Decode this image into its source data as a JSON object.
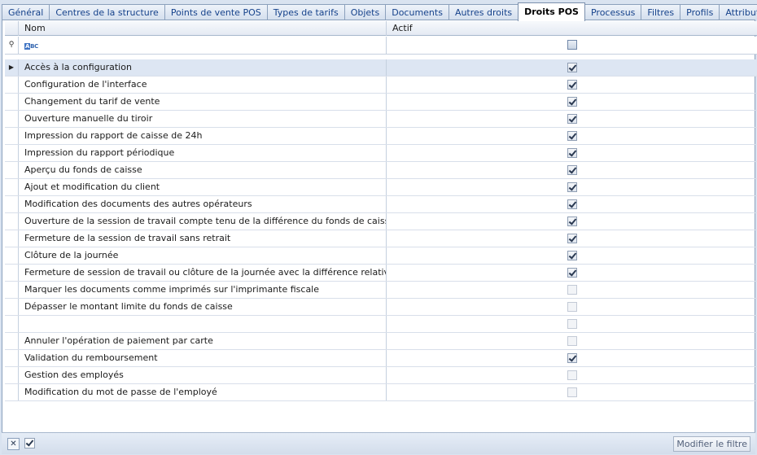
{
  "tabs": [
    {
      "label": "Général",
      "active": false
    },
    {
      "label": "Centres de la structure",
      "active": false
    },
    {
      "label": "Points de vente POS",
      "active": false
    },
    {
      "label": "Types de tarifs",
      "active": false
    },
    {
      "label": "Objets",
      "active": false
    },
    {
      "label": "Documents",
      "active": false
    },
    {
      "label": "Autres droits",
      "active": false
    },
    {
      "label": "Droits POS",
      "active": true
    },
    {
      "label": "Processus",
      "active": false
    },
    {
      "label": "Filtres",
      "active": false
    },
    {
      "label": "Profils",
      "active": false
    },
    {
      "label": "Attributs",
      "active": false
    }
  ],
  "grid": {
    "columns": {
      "nom": "Nom",
      "actif": "Actif"
    },
    "filter_row": {
      "pin_icon": "pin-icon",
      "abc_icon": "abc-filter-icon",
      "abc_label": "ABC",
      "actif_checked": false
    },
    "rows": [
      {
        "nom": "Accès à la configuration",
        "actif": true,
        "selected": true
      },
      {
        "nom": "Configuration de l'interface",
        "actif": true
      },
      {
        "nom": "Changement du tarif de vente",
        "actif": true
      },
      {
        "nom": "Ouverture manuelle du tiroir",
        "actif": true
      },
      {
        "nom": "Impression du rapport de caisse de 24h",
        "actif": true
      },
      {
        "nom": "Impression du rapport périodique",
        "actif": true
      },
      {
        "nom": "Aperçu du fonds de caisse",
        "actif": true
      },
      {
        "nom": "Ajout et modification du client",
        "actif": true
      },
      {
        "nom": "Modification des documents des autres opérateurs",
        "actif": true
      },
      {
        "nom": "Ouverture de la session de travail compte tenu de la différence du fonds de caisse",
        "actif": true
      },
      {
        "nom": "Fermeture de la session de travail sans retrait",
        "actif": true
      },
      {
        "nom": "Clôture de la journée",
        "actif": true
      },
      {
        "nom": "Fermeture de session de travail ou clôture de la journée avec la différence relative au...",
        "actif": true
      },
      {
        "nom": "Marquer les documents comme imprimés sur l'imprimante fiscale",
        "actif": false
      },
      {
        "nom": "Dépasser le montant limite du fonds de caisse",
        "actif": false
      },
      {
        "nom": "",
        "actif": false
      },
      {
        "nom": "Annuler l'opération de paiement par carte",
        "actif": false
      },
      {
        "nom": "Validation du remboursement",
        "actif": true
      },
      {
        "nom": "Gestion des employés",
        "actif": false
      },
      {
        "nom": "Modification du mot de passe de l'employé",
        "actif": false
      }
    ]
  },
  "footer": {
    "clear_filter_icon": "close-icon",
    "filter_enabled": true,
    "modify_filter_label": "Modifier le filtre"
  }
}
